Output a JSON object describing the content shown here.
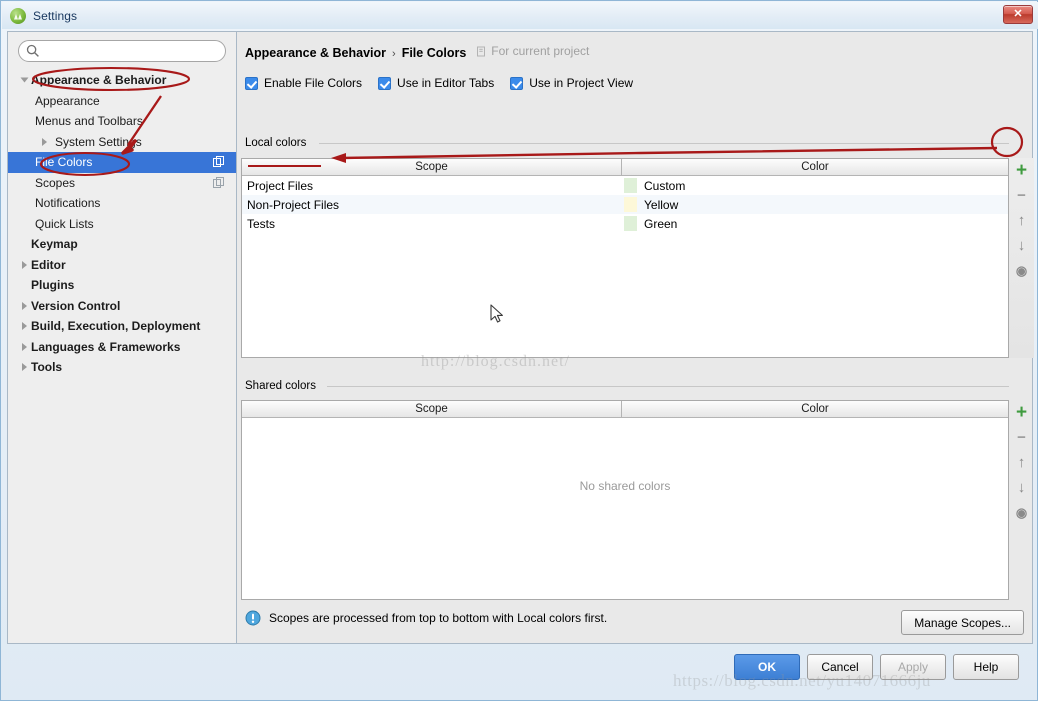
{
  "window": {
    "title": "Settings",
    "app_icon": "android-studio-icon",
    "close_label": "✕"
  },
  "search": {
    "value": "",
    "placeholder": "",
    "icon": "search-icon"
  },
  "sidebar": {
    "items": [
      {
        "label": "Appearance & Behavior",
        "level": 0,
        "arrow": "expanded",
        "selected": false,
        "badge": false
      },
      {
        "label": "Appearance",
        "level": 1,
        "arrow": "none",
        "selected": false,
        "badge": false
      },
      {
        "label": "Menus and Toolbars",
        "level": 1,
        "arrow": "none",
        "selected": false,
        "badge": false
      },
      {
        "label": "System Settings",
        "level": 1,
        "arrow": "collapsed",
        "selected": false,
        "badge": false
      },
      {
        "label": "File Colors",
        "level": 1,
        "arrow": "none",
        "selected": true,
        "badge": true
      },
      {
        "label": "Scopes",
        "level": 1,
        "arrow": "none",
        "selected": false,
        "badge": true
      },
      {
        "label": "Notifications",
        "level": 1,
        "arrow": "none",
        "selected": false,
        "badge": false
      },
      {
        "label": "Quick Lists",
        "level": 1,
        "arrow": "none",
        "selected": false,
        "badge": false
      },
      {
        "label": "Keymap",
        "level": 0,
        "arrow": "none",
        "selected": false,
        "badge": false
      },
      {
        "label": "Editor",
        "level": 0,
        "arrow": "collapsed",
        "selected": false,
        "badge": false
      },
      {
        "label": "Plugins",
        "level": 0,
        "arrow": "none",
        "selected": false,
        "badge": false
      },
      {
        "label": "Version Control",
        "level": 0,
        "arrow": "collapsed",
        "selected": false,
        "badge": false
      },
      {
        "label": "Build, Execution, Deployment",
        "level": 0,
        "arrow": "collapsed",
        "selected": false,
        "badge": false
      },
      {
        "label": "Languages & Frameworks",
        "level": 0,
        "arrow": "collapsed",
        "selected": false,
        "badge": false
      },
      {
        "label": "Tools",
        "level": 0,
        "arrow": "collapsed",
        "selected": false,
        "badge": false
      }
    ]
  },
  "main": {
    "breadcrumb": {
      "parent": "Appearance & Behavior",
      "separator": "›",
      "current": "File Colors",
      "note": "For current project",
      "note_icon": "project-scope-icon"
    },
    "checkboxes": [
      {
        "label": "Enable File Colors",
        "checked": true,
        "mnemonic": "F"
      },
      {
        "label": "Use in Editor Tabs",
        "checked": true,
        "mnemonic": "t"
      },
      {
        "label": "Use in Project View",
        "checked": true,
        "mnemonic": "P"
      }
    ],
    "local_colors": {
      "group_label": "Local colors",
      "columns": [
        "Scope",
        "Color"
      ],
      "rows": [
        {
          "scope": "Project Files",
          "color": "Custom",
          "swatch": "#dff0d8"
        },
        {
          "scope": "Non-Project Files",
          "color": "Yellow",
          "swatch": "#fdf8d8"
        },
        {
          "scope": "Tests",
          "color": "Green",
          "swatch": "#dff0d8"
        }
      ],
      "toolbar": [
        {
          "name": "add-button",
          "glyph": "+",
          "color": "#3f9b3f",
          "enabled": true
        },
        {
          "name": "remove-button",
          "glyph": "−",
          "color": "#9a9a9a",
          "enabled": false
        },
        {
          "name": "move-up-button",
          "glyph": "↑",
          "color": "#8a8a8a",
          "enabled": false
        },
        {
          "name": "move-down-button",
          "glyph": "↓",
          "color": "#8a8a8a",
          "enabled": false
        },
        {
          "name": "share-button",
          "glyph": "◉",
          "color": "#8a8a8a",
          "enabled": false
        }
      ]
    },
    "shared_colors": {
      "group_label": "Shared colors",
      "columns": [
        "Scope",
        "Color"
      ],
      "rows": [],
      "empty_message": "No shared colors",
      "toolbar": [
        {
          "name": "add-button",
          "glyph": "+",
          "color": "#3f9b3f",
          "enabled": true
        },
        {
          "name": "remove-button",
          "glyph": "−",
          "color": "#9a9a9a",
          "enabled": false
        },
        {
          "name": "move-up-button",
          "glyph": "↑",
          "color": "#8a8a8a",
          "enabled": false
        },
        {
          "name": "move-down-button",
          "glyph": "↓",
          "color": "#8a8a8a",
          "enabled": false
        },
        {
          "name": "unshare-button",
          "glyph": "◉",
          "color": "#8a8a8a",
          "enabled": false
        }
      ]
    },
    "info": {
      "icon": "info-icon",
      "text": "Scopes are processed from top to bottom with Local colors first."
    },
    "manage_scopes_label": "Manage Scopes..."
  },
  "footer": {
    "buttons": [
      {
        "label": "OK",
        "style": "primary",
        "enabled": true
      },
      {
        "label": "Cancel",
        "style": "normal",
        "enabled": true
      },
      {
        "label": "Apply",
        "style": "disabled",
        "enabled": false
      },
      {
        "label": "Help",
        "style": "normal",
        "enabled": true
      }
    ]
  },
  "watermarks": {
    "top": "http://blog.csdn.net/",
    "bottom": "https://blog.csdn.net/yu14071666ju"
  },
  "annotations": {
    "color": "#a81919",
    "items": [
      {
        "type": "ellipse",
        "target": "sidebar-item-appearance-behavior"
      },
      {
        "type": "ellipse",
        "target": "sidebar-item-file-colors"
      },
      {
        "type": "arrow",
        "target": "sidebar-item-file-colors"
      },
      {
        "type": "ellipse",
        "target": "local-colors-add-button"
      },
      {
        "type": "arrow",
        "target": "local-colors-row-project-files"
      },
      {
        "type": "underline",
        "target": "local-colors-row-project-files"
      }
    ]
  }
}
